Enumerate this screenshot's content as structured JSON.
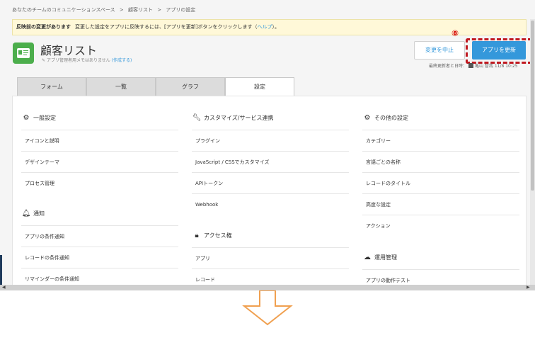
{
  "breadcrumb": [
    "あなたのチームのコミュニケーションスペース",
    ">",
    "顧客リスト",
    ">",
    "アプリの設定"
  ],
  "notice": {
    "title": "反映前の変更があります",
    "text": "変更した設定をアプリに反映するには、[アプリを更新]ボタンをクリックします（",
    "link": "ヘルプ",
    "end": "）。"
  },
  "app": {
    "title": "顧客リスト",
    "memo": "アプリ管理者用メモはありません",
    "memo_link": "(作成する)",
    "icon": "contact-card-icon"
  },
  "buttons": {
    "cancel": "変更を中止",
    "update": "アプリを更新"
  },
  "step_marker": "⑧",
  "last_updated": {
    "label": "最終更新者と日時：",
    "user": "亀山 智哉",
    "datetime": "11/8 10:25"
  },
  "tabs": [
    "フォーム",
    "一覧",
    "グラフ",
    "設定"
  ],
  "active_tab": "設定",
  "columns": [
    {
      "sections": [
        {
          "icon": "gear-icon",
          "title": "一般設定",
          "items": [
            "アイコンと説明",
            "デザインテーマ",
            "プロセス管理"
          ]
        },
        {
          "icon": "bell-icon",
          "title": "通知",
          "items": [
            "アプリの条件通知",
            "レコードの条件通知",
            "リマインダーの条件通知"
          ]
        }
      ]
    },
    {
      "sections": [
        {
          "icon": "wrench-icon",
          "title": "カスタマイズ/サービス連携",
          "items": [
            "プラグイン",
            "JavaScript / CSSでカスタマイズ",
            "APIトークン",
            "Webhook"
          ]
        },
        {
          "icon": "lock-icon",
          "title": "アクセス権",
          "items": [
            "アプリ",
            "レコード"
          ]
        }
      ]
    },
    {
      "sections": [
        {
          "icon": "gears-icon",
          "title": "その他の設定",
          "items": [
            "カテゴリー",
            "言語ごとの名称",
            "レコードのタイトル",
            "高度な設定",
            "アクション"
          ]
        },
        {
          "icon": "cloud-check-icon",
          "title": "運用管理",
          "items": [
            "アプリの動作テスト"
          ]
        }
      ]
    }
  ],
  "colors": {
    "accent": "#3498db",
    "highlight": "#c0181f",
    "arrow": "#f0a050"
  }
}
